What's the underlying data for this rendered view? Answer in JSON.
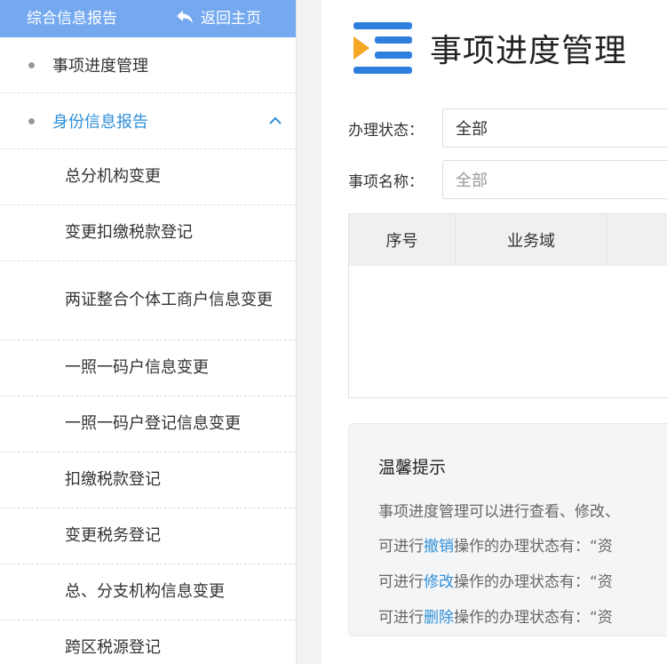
{
  "sidebar": {
    "title": "综合信息报告",
    "back_label": "返回主页",
    "items": [
      {
        "label": "事项进度管理"
      },
      {
        "label": "身份信息报告"
      }
    ],
    "sub_items": [
      {
        "label": "总分机构变更"
      },
      {
        "label": "变更扣缴税款登记"
      },
      {
        "label": "两证整合个体工商户信息变更"
      },
      {
        "label": "一照一码户信息变更"
      },
      {
        "label": "一照一码户登记信息变更"
      },
      {
        "label": "扣缴税款登记"
      },
      {
        "label": "变更税务登记"
      },
      {
        "label": "总、分支机构信息变更"
      },
      {
        "label": "跨区税源登记"
      }
    ]
  },
  "main": {
    "title": "事项进度管理",
    "status_label": "办理状态：",
    "status_value": "全部",
    "name_label": "事项名称：",
    "name_placeholder": "全部",
    "table_headers": [
      "序号",
      "业务域"
    ],
    "tips": {
      "title": "温馨提示",
      "line1": "事项进度管理可以进行查看、修改、",
      "line2_prefix": "可进行",
      "line2_action": "撤销",
      "line2_suffix": "操作的办理状态有：“资",
      "line3_prefix": "可进行",
      "line3_action": "修改",
      "line3_suffix": "操作的办理状态有：“资",
      "line4_prefix": "可进行",
      "line4_action": "删除",
      "line4_suffix": "操作的办理状态有：“资"
    }
  },
  "colors": {
    "sidebar_header_bg": "#74a9f0",
    "accent_blue": "#2e8fd8",
    "logo_blue": "#2f7fe0",
    "logo_orange": "#f5a623"
  },
  "icons": {
    "back": "return-arrow-icon",
    "expand": "chevron-up-icon",
    "dropdown": "chevron-down-icon",
    "logo": "list-play-icon"
  }
}
